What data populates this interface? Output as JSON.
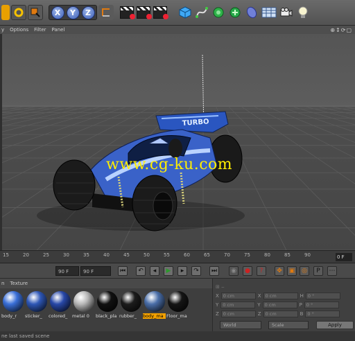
{
  "toolbar": {
    "axis_x": "X",
    "axis_y": "Y",
    "axis_z": "Z",
    "icons": [
      "move-icon",
      "rotate-icon",
      "select-icon",
      "x-axis-icon",
      "y-axis-icon",
      "z-axis-icon",
      "coordinate-icon",
      "render-view-icon",
      "render-active-icon",
      "render-settings-icon",
      "cube-icon",
      "spline-icon",
      "nurbs-icon",
      "array-icon",
      "deformer-icon",
      "scene-icon",
      "camera-icon",
      "light-icon"
    ]
  },
  "menubar": {
    "items": [
      "y",
      "Options",
      "Filter",
      "Panel"
    ],
    "nav_icons": "⊕↕⟳▢"
  },
  "viewport": {
    "watermark": "www.cg-ku.com",
    "car_decal": "TURBO"
  },
  "timeline": {
    "ticks": [
      "15",
      "20",
      "25",
      "30",
      "35",
      "40",
      "45",
      "50",
      "55",
      "60",
      "65",
      "70",
      "75",
      "80",
      "85",
      "90"
    ],
    "current_frame": "0 F"
  },
  "transport": {
    "start_field": "90 F",
    "end_field": "90 F"
  },
  "materials": {
    "menu": [
      "n",
      "Texture"
    ],
    "items": [
      {
        "label": "body_r",
        "color": "#3a6fd8",
        "selected": false
      },
      {
        "label": "sticker_",
        "color": "#2e57b6",
        "selected": false
      },
      {
        "label": "colored_",
        "color": "#2848a8",
        "selected": false
      },
      {
        "label": "metal 0",
        "color": "#b8b8b8",
        "selected": false
      },
      {
        "label": "black_pla",
        "color": "#111111",
        "selected": false
      },
      {
        "label": "rubber_",
        "color": "#1c1c1c",
        "selected": false
      },
      {
        "label": "body_ma",
        "color": "#4a6ea8",
        "selected": true
      },
      {
        "label": "Floor_ma",
        "color": "#151515",
        "selected": false
      }
    ]
  },
  "coordinates": {
    "rows": [
      {
        "a": "X",
        "av": "0 cm",
        "b": "X",
        "bv": "0 cm",
        "c": "H",
        "cv": "0 °"
      },
      {
        "a": "Y",
        "av": "0 cm",
        "b": "Y",
        "bv": "0 cm",
        "c": "P",
        "cv": "0 °"
      },
      {
        "a": "Z",
        "av": "0 cm",
        "b": "Z",
        "bv": "0 cm",
        "c": "B",
        "cv": "0 °"
      }
    ],
    "mode_select": "World",
    "scale_select": "Scale",
    "apply_label": "Apply"
  },
  "status": {
    "text": "ne last saved scene"
  }
}
